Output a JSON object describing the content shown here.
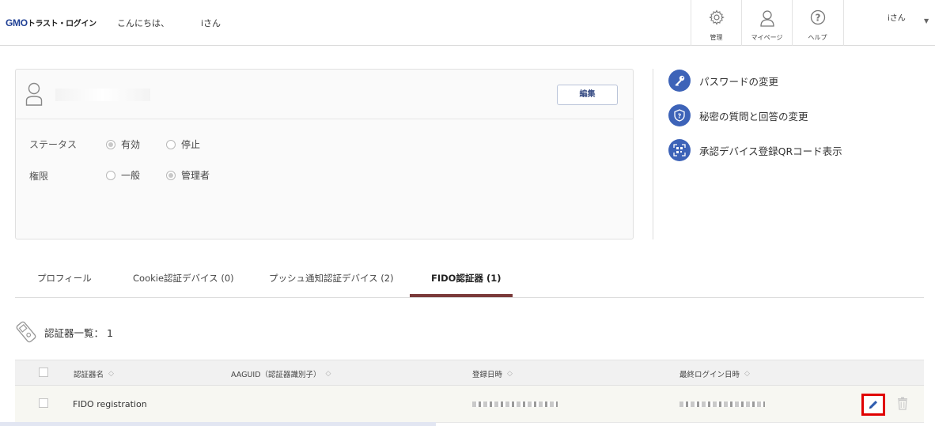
{
  "header": {
    "logo_brand": "GMO",
    "logo_product": "トラスト・ログイン",
    "greeting": "こんにちは、",
    "greeting_suffix": "iさん",
    "nav": [
      {
        "label": "管理",
        "icon": "gear-icon"
      },
      {
        "label": "マイページ",
        "icon": "person-icon"
      },
      {
        "label": "ヘルプ",
        "icon": "question-icon"
      }
    ],
    "user_name": "iさん"
  },
  "profile": {
    "edit_label": "編集",
    "status_label": "ステータス",
    "status_options": [
      "有効",
      "停止"
    ],
    "status_selected": "有効",
    "role_label": "権限",
    "role_options": [
      "一般",
      "管理者"
    ],
    "role_selected": "管理者"
  },
  "side_links": [
    {
      "label": "パスワードの変更",
      "icon": "key-icon"
    },
    {
      "label": "秘密の質問と回答の変更",
      "icon": "shield-question-icon"
    },
    {
      "label": "承認デバイス登録QRコード表示",
      "icon": "qr-code-icon"
    }
  ],
  "tabs": [
    {
      "label": "プロフィール"
    },
    {
      "label": "Cookie認証デバイス (0)"
    },
    {
      "label": "プッシュ通知認証デバイス (2)"
    },
    {
      "label": "FIDO認証器 (1)",
      "active": true
    }
  ],
  "list": {
    "title": "認証器一覧：",
    "count": "1"
  },
  "table": {
    "columns": [
      "認証器名",
      "AAGUID（認証器識別子）",
      "登録日時",
      "最終ログイン日時"
    ],
    "rows": [
      {
        "name": "FIDO registration",
        "aaguid": ""
      }
    ]
  },
  "colors": {
    "accent": "#3d63b8",
    "tab_underline": "#7a3a3a",
    "highlight": "#e00000"
  }
}
